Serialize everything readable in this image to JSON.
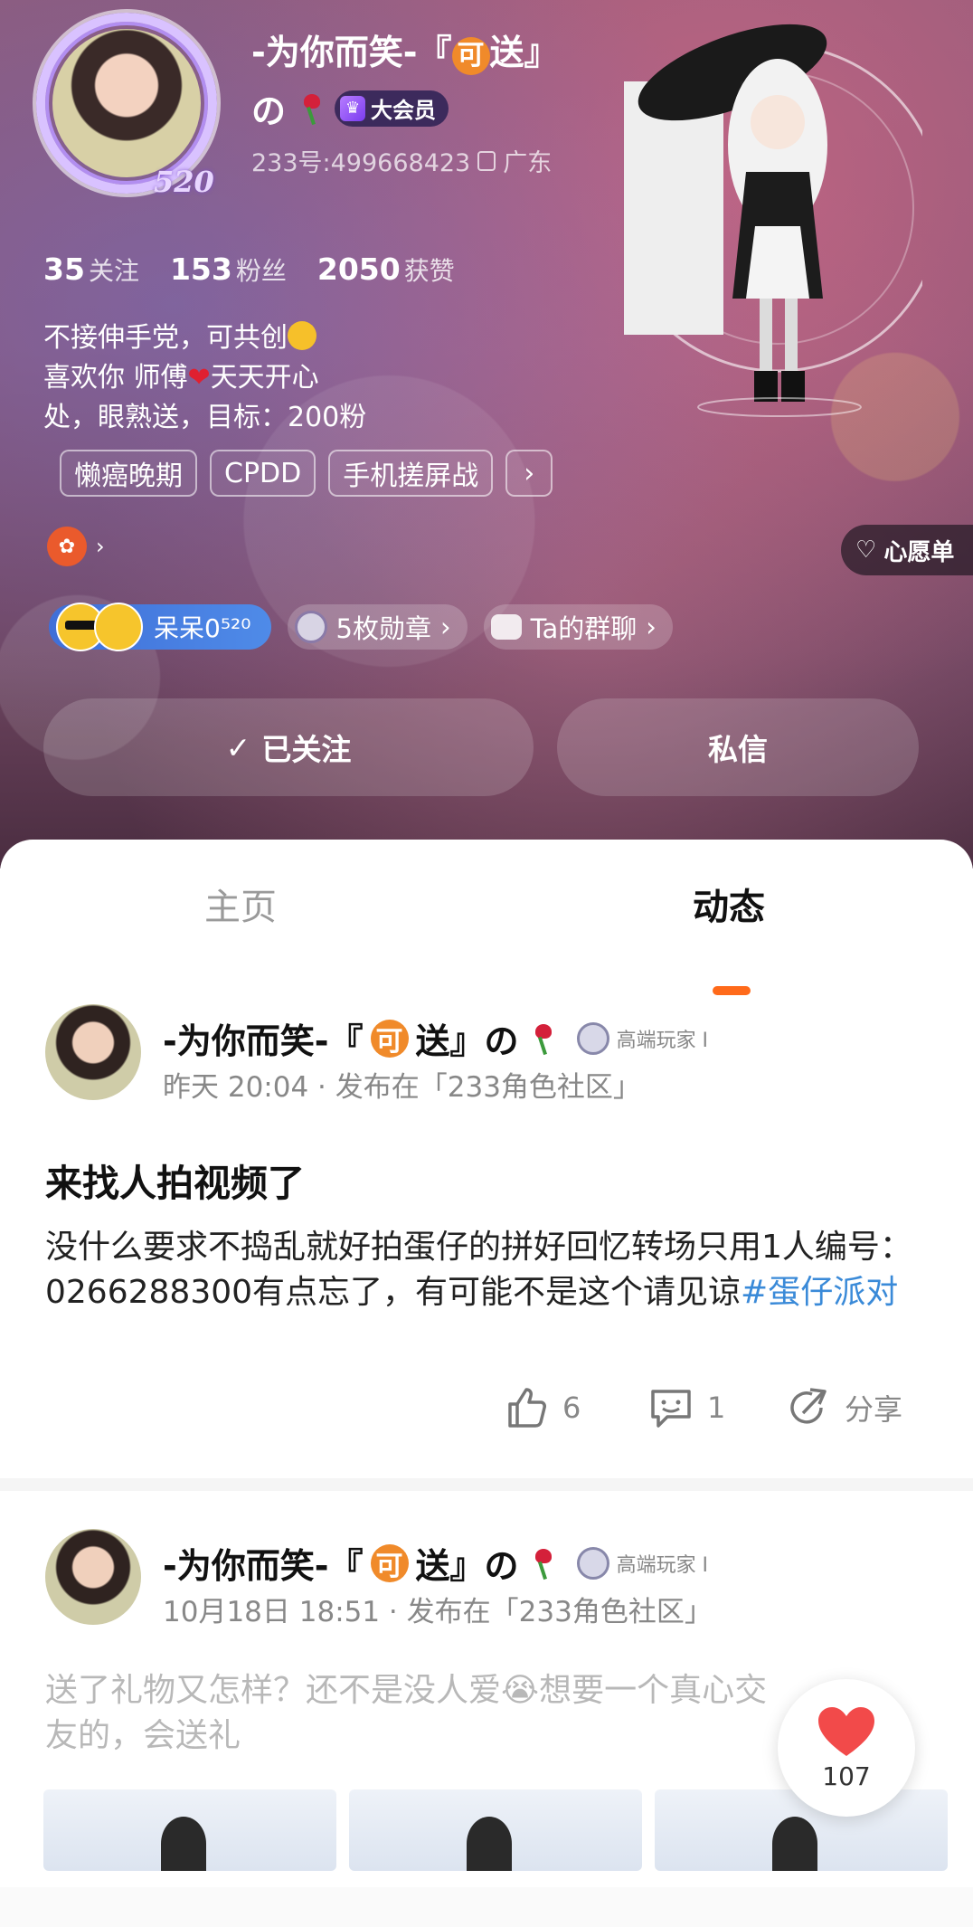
{
  "profile": {
    "nickname_line1": "-为你而笑-『",
    "nickname_ke": "可",
    "nickname_rest": "送』",
    "nickname_line2": "の",
    "vip_label": "大会员",
    "id_text": "233号:499668423",
    "location": "广东",
    "avatar_badge": "520",
    "stats": [
      {
        "num": "35",
        "label": "关注"
      },
      {
        "num": "153",
        "label": "粉丝"
      },
      {
        "num": "2050",
        "label": "获赞"
      }
    ],
    "bio_line1": "不接伸手党，可共创",
    "bio_line2a": "喜欢你  师傅",
    "bio_line2b": "天天开心",
    "bio_line3": "处，眼熟送，目标：200粉",
    "tags": [
      "懒癌晚期",
      "CPDD",
      "手机搓屏战"
    ],
    "tag_more": "›",
    "app_chevron": "›",
    "wishlist_label": "心愿单",
    "fan_group_label": "呆呆0⁵²⁰",
    "medals_label": "5枚勋章",
    "group_chat_label": "Ta的群聊",
    "follow_label": "已关注",
    "dm_label": "私信"
  },
  "tabs": {
    "home": "主页",
    "feed": "动态"
  },
  "posts": [
    {
      "author_prefix": "-为你而笑-『",
      "author_ke": "可",
      "author_suffix": "送』の",
      "player_badge": "高端玩家 I",
      "meta": "昨天 20:04 · 发布在「233角色社区」",
      "title": "来找人拍视频了",
      "body": "没什么要求不捣乱就好拍蛋仔的拼好回忆转场只用1人编号：0266288300有点忘了，有可能不是这个请见谅",
      "hashtag": "#蛋仔派对",
      "likes": "6",
      "comments": "1",
      "share": "分享"
    },
    {
      "author_prefix": "-为你而笑-『",
      "author_ke": "可",
      "author_suffix": "送』の",
      "player_badge": "高端玩家 I",
      "meta": "10月18日 18:51 · 发布在「233角色社区」",
      "body": "送了礼物又怎样？还不是没人爱😭想要一个真心交友的，会送礼"
    }
  ],
  "floating_like": {
    "count": "107"
  },
  "colors": {
    "accent": "#ff6a1a",
    "hashtag": "#3a8ad8",
    "like_heart": "#f24a4a"
  }
}
